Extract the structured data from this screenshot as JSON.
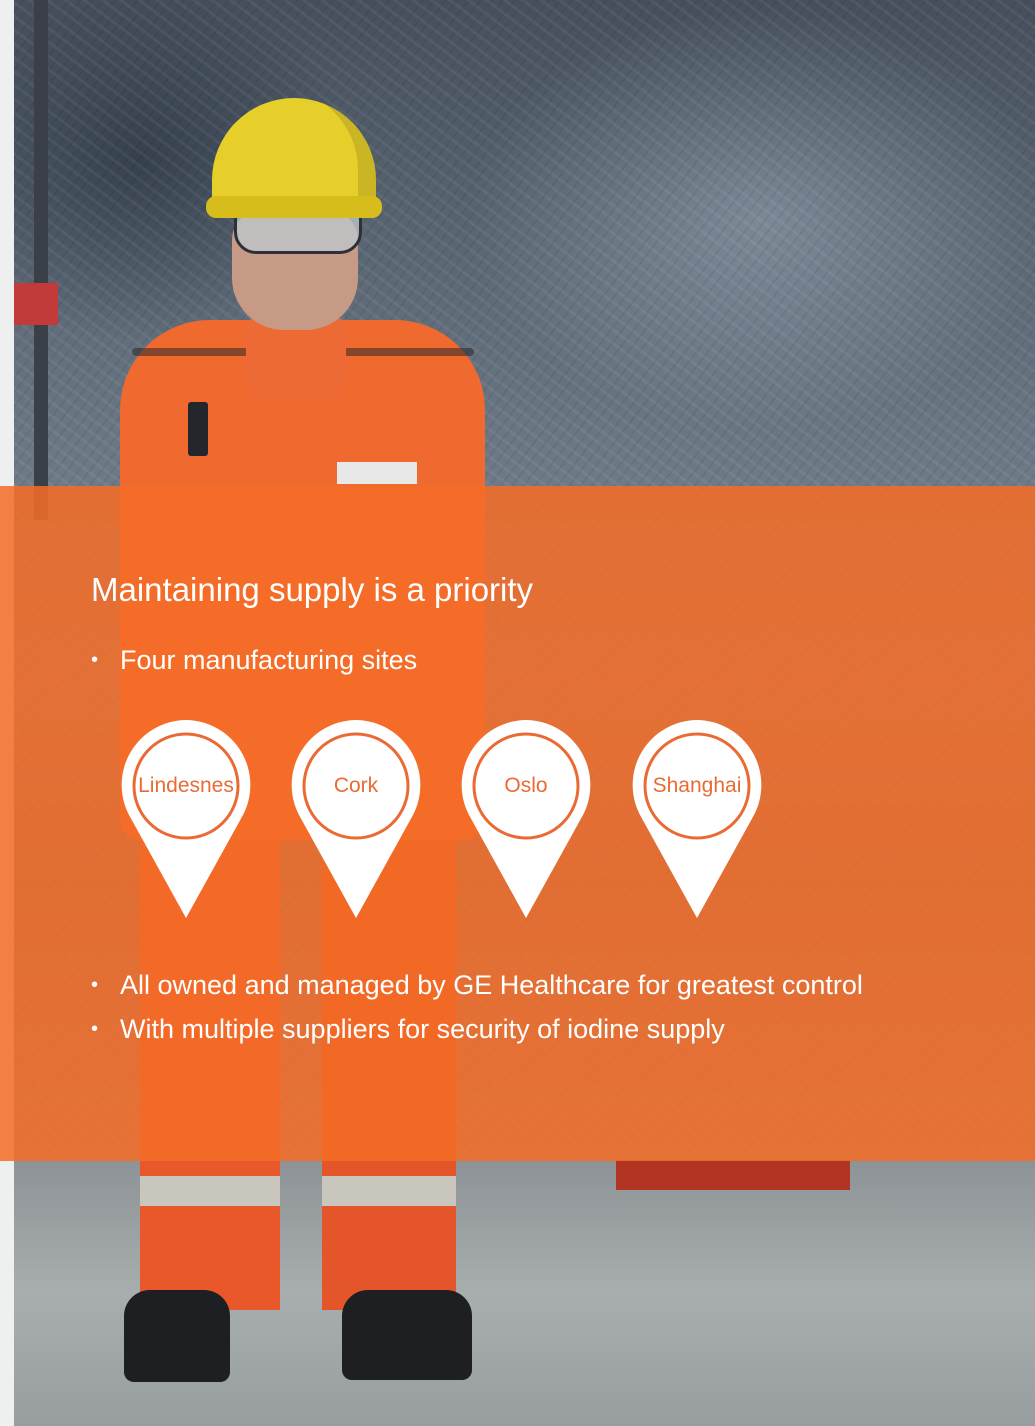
{
  "heading": "Maintaining supply is a priority",
  "bullets_top": [
    "Four manufacturing sites"
  ],
  "sites": [
    {
      "name": "Lindesnes"
    },
    {
      "name": "Cork"
    },
    {
      "name": "Oslo"
    },
    {
      "name": "Shanghai"
    }
  ],
  "bullets_bottom": [
    "All owned and managed by GE Healthcare for greatest control",
    "With multiple suppliers for security of iodine supply"
  ],
  "colors": {
    "overlay": "#f56c26",
    "pin_fill": "#ffffff",
    "pin_ring": "#ea6a34",
    "text": "#ffffff"
  },
  "icons": [
    "map-pin-icon"
  ]
}
